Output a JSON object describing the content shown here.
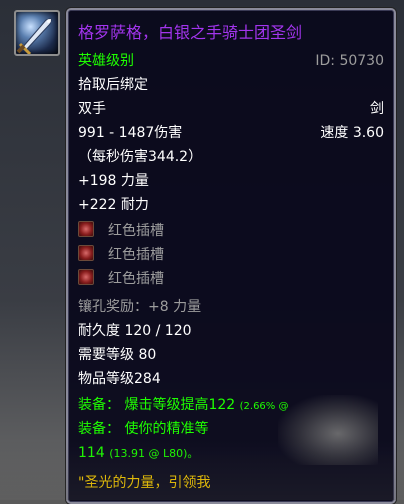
{
  "item": {
    "name": "格罗萨格，白银之手骑士团圣剑",
    "quality": "英雄级别",
    "id_label": "ID: 50730",
    "bind": "拾取后绑定",
    "hand": "双手",
    "weapon_type": "剑",
    "damage": "991 - 1487伤害",
    "speed": "速度 3.60",
    "dps": "（每秒伤害344.2）",
    "stat_strength": "+198 力量",
    "stat_stamina": "+222 耐力",
    "sockets": [
      "红色插槽",
      "红色插槽",
      "红色插槽"
    ],
    "socket_bonus": "镶孔奖励：+8 力量",
    "durability": "耐久度 120 / 120",
    "required_level": "需要等级 80",
    "item_level": "物品等级284",
    "equip_crit": "装备： 爆击等级提高122",
    "equip_crit_note": "(2.66% @",
    "equip_hit": "装备： 使你的精准等",
    "equip_hit_value": "114",
    "equip_hit_note": "(13.91 @ L80)。",
    "flavor": "\"圣光的力量，引领我"
  },
  "colors": {
    "epic": "#a335ee",
    "uncommon": "#1eff00",
    "poor": "#9d9d9d",
    "flavor": "#ffd100"
  },
  "icons": {
    "item_icon": "sword-icon",
    "socket_icon": "red-socket-icon"
  }
}
